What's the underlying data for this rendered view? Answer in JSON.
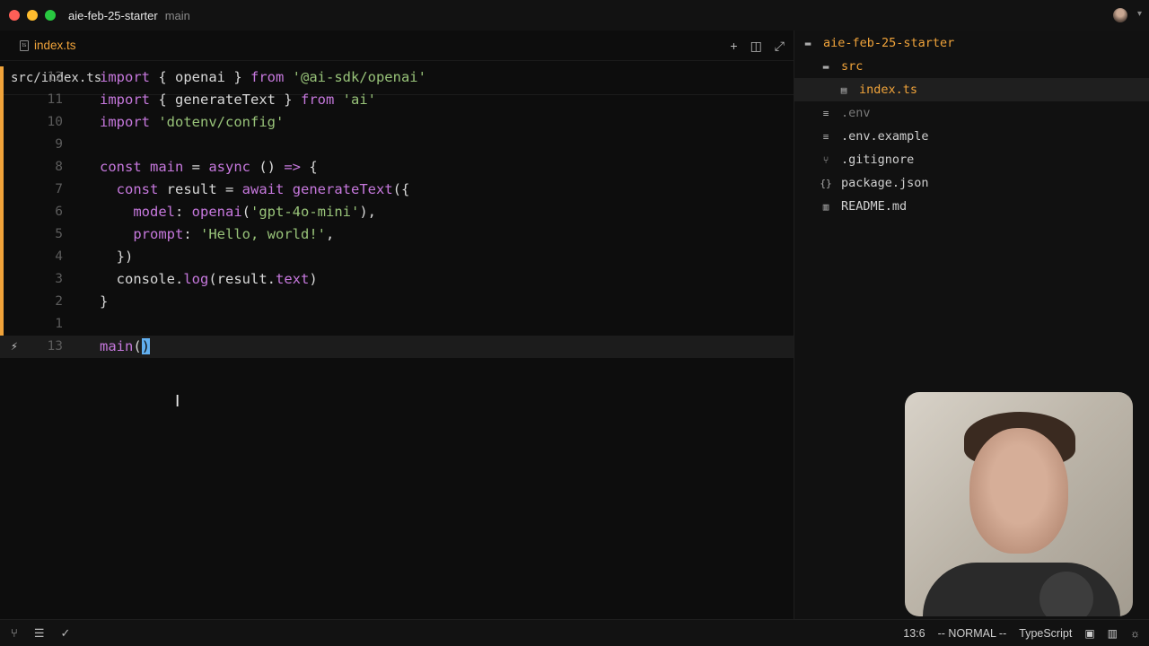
{
  "window": {
    "title": "aie-feb-25-starter",
    "branch": "main"
  },
  "editor": {
    "tab_label": "index.ts",
    "tab_icon": "typescript-file-icon",
    "breadcrumb": "src/index.ts",
    "actions": [
      "+",
      "split",
      "expand"
    ],
    "lines": [
      {
        "num": "12",
        "tokens": [
          [
            "kw",
            "import"
          ],
          [
            "plain",
            " { openai } "
          ],
          [
            "kw",
            "from"
          ],
          [
            "plain",
            " "
          ],
          [
            "str",
            "'@ai-sdk/openai'"
          ]
        ]
      },
      {
        "num": "11",
        "tokens": [
          [
            "kw",
            "import"
          ],
          [
            "plain",
            " { generateText } "
          ],
          [
            "kw",
            "from"
          ],
          [
            "plain",
            " "
          ],
          [
            "str",
            "'ai'"
          ]
        ]
      },
      {
        "num": "10",
        "tokens": [
          [
            "kw",
            "import"
          ],
          [
            "plain",
            " "
          ],
          [
            "str",
            "'dotenv/config'"
          ]
        ]
      },
      {
        "num": "9",
        "tokens": []
      },
      {
        "num": "8",
        "tokens": [
          [
            "kw",
            "const"
          ],
          [
            "plain",
            " "
          ],
          [
            "fn",
            "main"
          ],
          [
            "plain",
            " = "
          ],
          [
            "kw",
            "async"
          ],
          [
            "plain",
            " () "
          ],
          [
            "kw",
            "=>"
          ],
          [
            "plain",
            " {"
          ]
        ]
      },
      {
        "num": "7",
        "tokens": [
          [
            "plain",
            "  "
          ],
          [
            "kw",
            "const"
          ],
          [
            "plain",
            " result = "
          ],
          [
            "kw",
            "await"
          ],
          [
            "plain",
            " "
          ],
          [
            "fn",
            "generateText"
          ],
          [
            "plain",
            "({"
          ]
        ]
      },
      {
        "num": "6",
        "tokens": [
          [
            "plain",
            "    "
          ],
          [
            "prop",
            "model"
          ],
          [
            "plain",
            ": "
          ],
          [
            "fn",
            "openai"
          ],
          [
            "plain",
            "("
          ],
          [
            "str",
            "'gpt-4o-mini'"
          ],
          [
            "plain",
            "),"
          ]
        ]
      },
      {
        "num": "5",
        "tokens": [
          [
            "plain",
            "    "
          ],
          [
            "prop",
            "prompt"
          ],
          [
            "plain",
            ": "
          ],
          [
            "str",
            "'Hello, world!'"
          ],
          [
            "plain",
            ","
          ]
        ]
      },
      {
        "num": "4",
        "tokens": [
          [
            "plain",
            "  })"
          ]
        ]
      },
      {
        "num": "3",
        "tokens": [
          [
            "plain",
            "  console."
          ],
          [
            "fn",
            "log"
          ],
          [
            "plain",
            "(result."
          ],
          [
            "prop",
            "text"
          ],
          [
            "plain",
            ")"
          ]
        ]
      },
      {
        "num": "2",
        "tokens": [
          [
            "plain",
            "}"
          ]
        ]
      },
      {
        "num": "1",
        "tokens": []
      },
      {
        "num": "13",
        "tokens": [
          [
            "fn",
            "main"
          ],
          [
            "plain",
            "("
          ],
          [
            "cursor",
            ")"
          ]
        ]
      }
    ]
  },
  "sidebar": {
    "root": "aie-feb-25-starter",
    "items": [
      {
        "label": "src",
        "kind": "folder",
        "icon": "folder-icon"
      },
      {
        "label": "index.ts",
        "kind": "nested",
        "icon": "typescript-file-icon"
      },
      {
        "label": ".env",
        "kind": "file dim",
        "icon": "lines-icon"
      },
      {
        "label": ".env.example",
        "kind": "file",
        "icon": "lines-icon"
      },
      {
        "label": ".gitignore",
        "kind": "file",
        "icon": "git-icon"
      },
      {
        "label": "package.json",
        "kind": "file",
        "icon": "braces-icon"
      },
      {
        "label": "README.md",
        "kind": "file",
        "icon": "book-icon"
      }
    ]
  },
  "status": {
    "position": "13:6",
    "mode": "-- NORMAL --",
    "language": "TypeScript"
  },
  "colors": {
    "accent": "#f0a33a",
    "keyword": "#c678dd",
    "string": "#98c379"
  }
}
